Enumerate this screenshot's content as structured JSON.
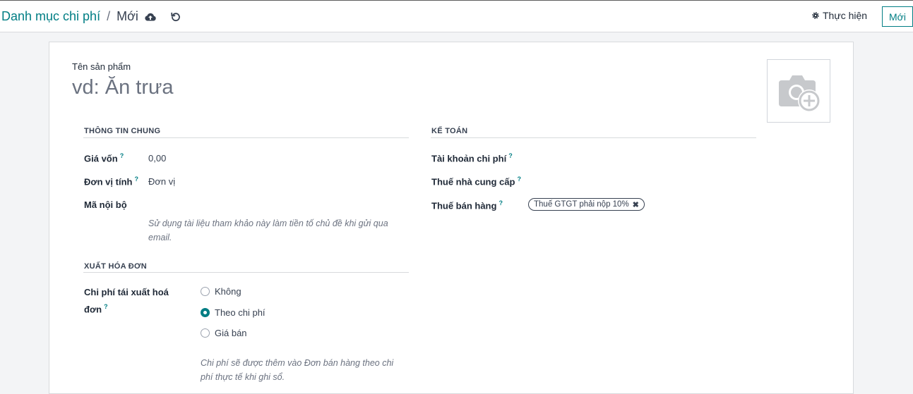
{
  "breadcrumb": {
    "parent": "Danh mục chi phí",
    "separator": "/",
    "current": "Mới"
  },
  "toolbar": {
    "save_icon": "cloud-upload-icon",
    "discard_icon": "undo-icon",
    "actions_icon": "gear-icon",
    "actions_label": "Thực hiện",
    "new_label": "Mới"
  },
  "form": {
    "name_label": "Tên sản phẩm",
    "name_placeholder": "vd: Ăn trưa",
    "image_icon": "camera-add-icon",
    "general": {
      "title": "THÔNG TIN CHUNG",
      "cost_label": "Giá vốn",
      "cost_value": "0,00",
      "uom_label": "Đơn vị tính",
      "uom_value": "Đơn vị",
      "ref_label": "Mã nội bộ",
      "ref_help": "Sử dụng tài liệu tham khảo này làm tiền tố chủ đề khi gửi qua email."
    },
    "invoicing": {
      "title": "XUẤT HÓA ĐƠN",
      "reinvoice_label": "Chi phí tái xuất hoá đơn",
      "options": [
        {
          "label": "Không",
          "checked": false
        },
        {
          "label": "Theo chi phí",
          "checked": true
        },
        {
          "label": "Giá bán",
          "checked": false
        }
      ],
      "reinvoice_help": "Chi phí sẽ được thêm vào Đơn bán hàng theo chi phí thực tế khi ghi sổ."
    },
    "accounting": {
      "title": "KẾ TOÁN",
      "expense_account_label": "Tài khoản chi phí",
      "vendor_tax_label": "Thuế nhà cung cấp",
      "sales_tax_label": "Thuế bán hàng",
      "sales_tax_tags": [
        "Thuế GTGT phải nộp 10%"
      ]
    },
    "help_marker": "?"
  },
  "colors": {
    "accent": "#017e84",
    "background": "#f3f4f6",
    "sheet": "#ffffff"
  }
}
